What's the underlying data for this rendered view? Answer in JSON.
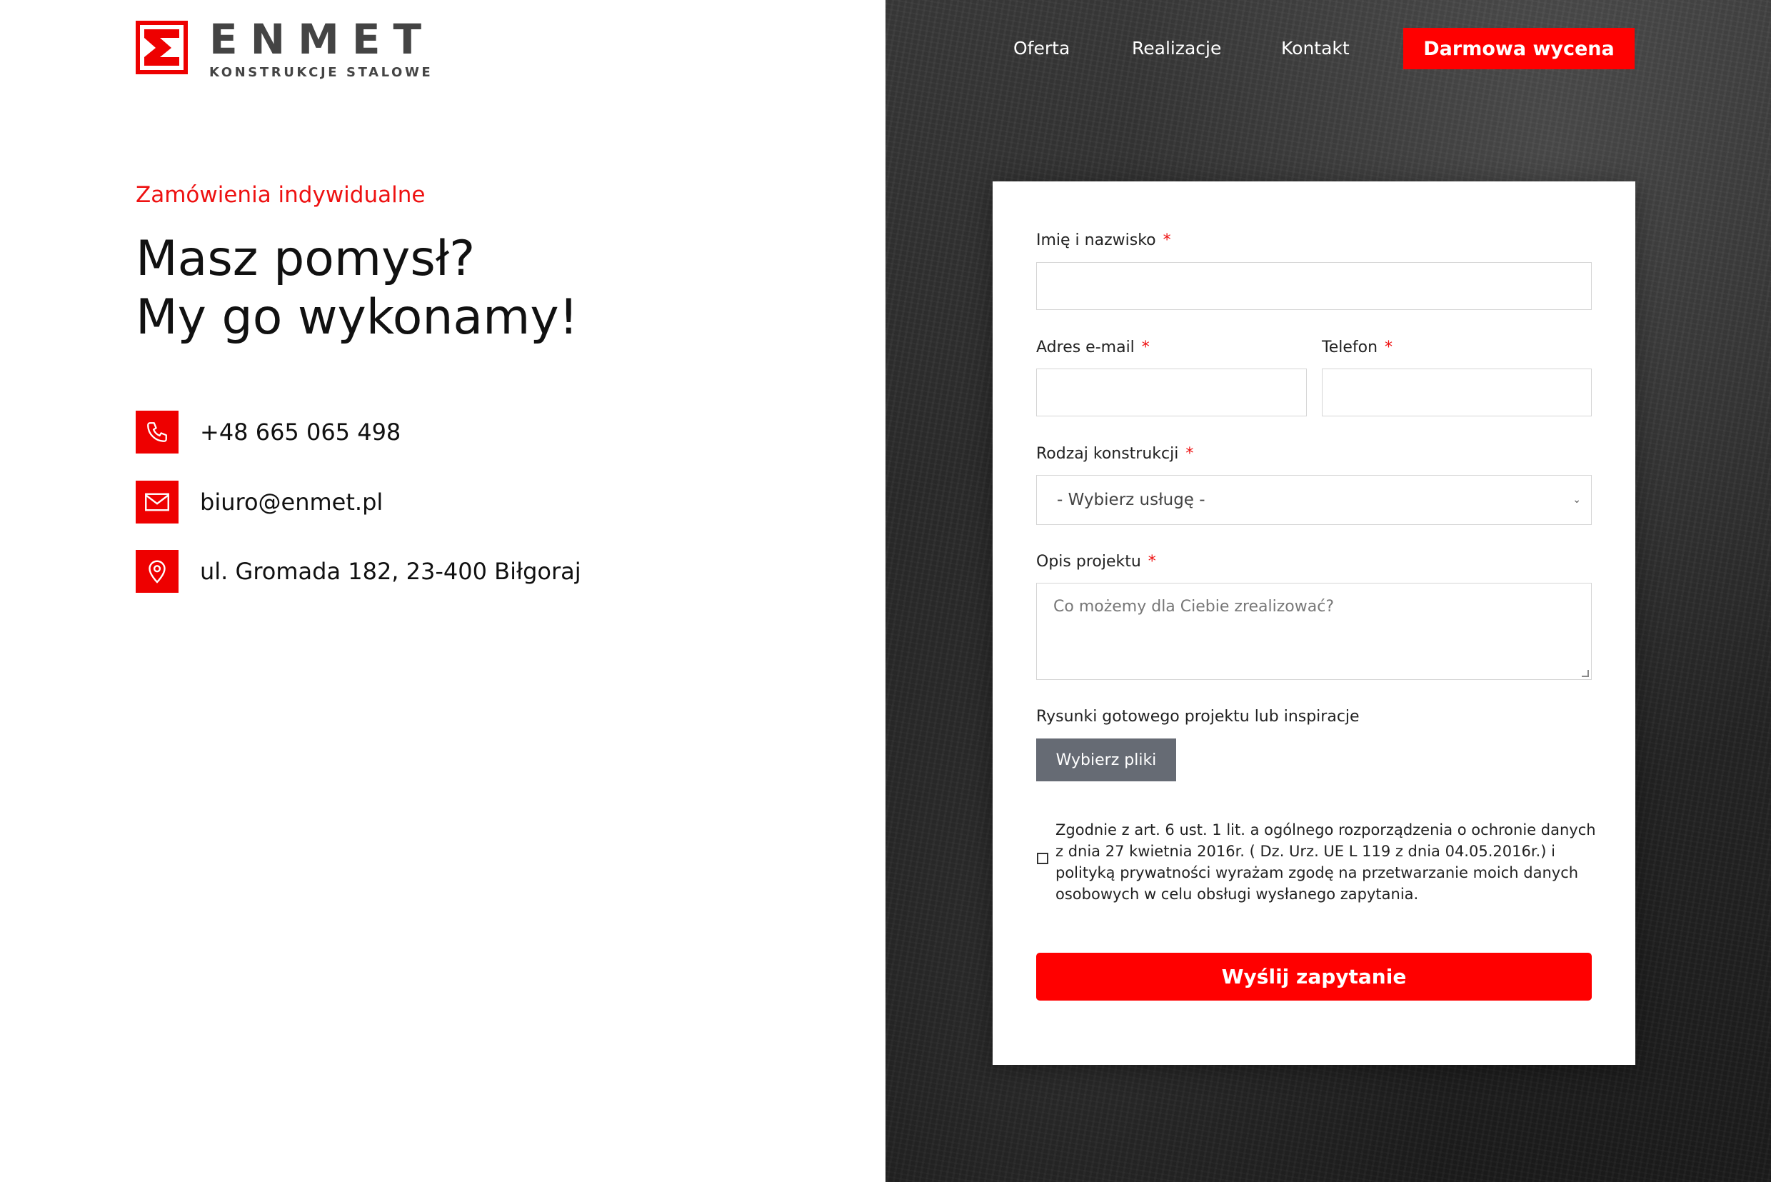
{
  "logo": {
    "name": "ENMET",
    "tagline": "KONSTRUKCJE STALOWE",
    "mark_icon": "enmet-e-logo",
    "brand_color": "#ee0000"
  },
  "hero": {
    "eyebrow": "Zamówienia indywidualne",
    "title_line1": "Masz pomysł?",
    "title_line2": "My go wykonamy!"
  },
  "contacts": {
    "phone": {
      "icon": "phone-icon",
      "text": "+48 665 065 498"
    },
    "email": {
      "icon": "mail-icon",
      "text": "biuro@enmet.pl"
    },
    "address": {
      "icon": "location-pin-icon",
      "text": "ul. Gromada 182, 23-400 Biłgoraj"
    }
  },
  "nav": {
    "items": [
      "Oferta",
      "Realizacje",
      "Kontakt"
    ],
    "cta": "Darmowa wycena"
  },
  "form": {
    "name_label": "Imię i nazwisko",
    "email_label": "Adres e-mail",
    "phone_label": "Telefon",
    "type_label": "Rodzaj konstrukcji",
    "type_selected": "- Wybierz usługę -",
    "desc_label": "Opis projektu",
    "desc_placeholder": "Co możemy dla Ciebie zrealizować?",
    "files_label": "Rysunki gotowego projektu lub inspiracje",
    "files_button": "Wybierz pliki",
    "required_mark": "*",
    "consent": "Zgodnie z art. 6 ust. 1 lit. a ogólnego rozporządzenia o ochronie danych z dnia 27 kwietnia 2016r. ( Dz. Urz. UE L 119 z dnia 04.05.2016r.) i polityką prywatności wyrażam zgodę na przetwarzanie moich danych osobowych w celu obsługi wysłanego zapytania.",
    "consent_checked": false,
    "submit": "Wyślij zapytanie"
  },
  "colors": {
    "accent": "#ff0000",
    "dark_bg": "#2a2a2a",
    "file_button": "#666b74"
  }
}
